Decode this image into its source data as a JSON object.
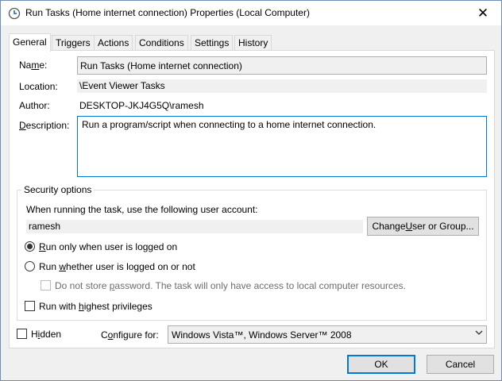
{
  "window": {
    "title": "Run Tasks (Home internet connection) Properties (Local Computer)",
    "close_glyph": "✕"
  },
  "tabs": [
    {
      "label": "General",
      "active": true
    },
    {
      "label": "Triggers",
      "active": false
    },
    {
      "label": "Actions",
      "active": false
    },
    {
      "label": "Conditions",
      "active": false
    },
    {
      "label": "Settings",
      "active": false
    },
    {
      "label": "History",
      "active": false
    }
  ],
  "general": {
    "name_label_pre": "Na",
    "name_label_u": "m",
    "name_label_post": "e:",
    "name_value": "Run Tasks (Home internet connection)",
    "location_label": "Location:",
    "location_value": "\\Event Viewer Tasks",
    "author_label": "Author:",
    "author_value": "DESKTOP-JKJ4G5Q\\ramesh",
    "description_label_u": "D",
    "description_label_post": "escription:",
    "description_value": "Run a program/script when connecting to a home internet connection."
  },
  "security": {
    "group_title": "Security options",
    "account_prompt": "When running the task, use the following user account:",
    "account_value": "ramesh",
    "change_button_pre": "Change ",
    "change_button_u": "U",
    "change_button_post": "ser or Group...",
    "radio_logged_on_u": "R",
    "radio_logged_on_post": "un only when user is logged on",
    "radio_logged_on_selected": true,
    "radio_whether_pre": "Run ",
    "radio_whether_u": "w",
    "radio_whether_post": "hether user is logged on or not",
    "radio_whether_selected": false,
    "no_store_password_pre": "Do not store ",
    "no_store_password_u": "p",
    "no_store_password_post": "assword.  The task will only have access to local computer resources.",
    "highest_priv_pre": "Run with ",
    "highest_priv_u": "h",
    "highest_priv_post": "ighest privileges"
  },
  "bottom": {
    "hidden_pre": "H",
    "hidden_u": "i",
    "hidden_post": "dden",
    "configure_label_pre": "C",
    "configure_label_u": "o",
    "configure_label_post": "nfigure for:",
    "configure_value": "Windows Vista™, Windows Server™ 2008"
  },
  "buttons": {
    "ok": "OK",
    "cancel": "Cancel"
  },
  "colors": {
    "accent": "#0078d7",
    "dialog_bg": "#f0f0f0"
  }
}
